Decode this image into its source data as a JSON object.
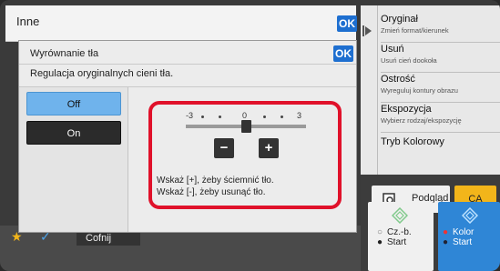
{
  "top_bar": {
    "title": "Inne",
    "ok_label": "OK"
  },
  "dialog": {
    "title": "Wyrównanie tła",
    "ok_label": "OK",
    "description": "Regulacja oryginalnych cieni tła.",
    "options": [
      {
        "label": "Off",
        "selected": true
      },
      {
        "label": "On",
        "selected": false
      }
    ],
    "scale": {
      "min_label": "-3",
      "mid_label": "0",
      "max_label": "3",
      "value": 0,
      "min": -3,
      "max": 3
    },
    "minus_label": "−",
    "plus_label": "+",
    "hint_line1": "Wskaż [+], żeby ściemnić tło.",
    "hint_line2": "Wskaż [-], żeby usunąć tło."
  },
  "right_menu": [
    {
      "main": "Oryginał",
      "sub": "Zmień format/kierunek"
    },
    {
      "main": "Usuń",
      "sub": "Usuń cień dookoła"
    },
    {
      "main": "Ostrość",
      "sub": "Wyreguluj kontury obrazu"
    },
    {
      "main": "Ekspozycja",
      "sub": "Wybierz rodzaj/ekspozycję"
    },
    {
      "main": "Tryb Kolorowy",
      "sub": ""
    }
  ],
  "buttons": {
    "preview": "Podgląd",
    "ca": "CA",
    "bw_start_line1": "Cz.-b.",
    "bw_start_line2": "Start",
    "color_start_line1": "Kolor",
    "color_start_line2": "Start",
    "back": "Cofnij"
  },
  "colors": {
    "accent_blue": "#1e6fd0",
    "highlight_red": "#e0112a",
    "ca_yellow": "#f2b51a",
    "color_start_blue": "#2f86d6",
    "selected_option": "#6fb3ec"
  }
}
